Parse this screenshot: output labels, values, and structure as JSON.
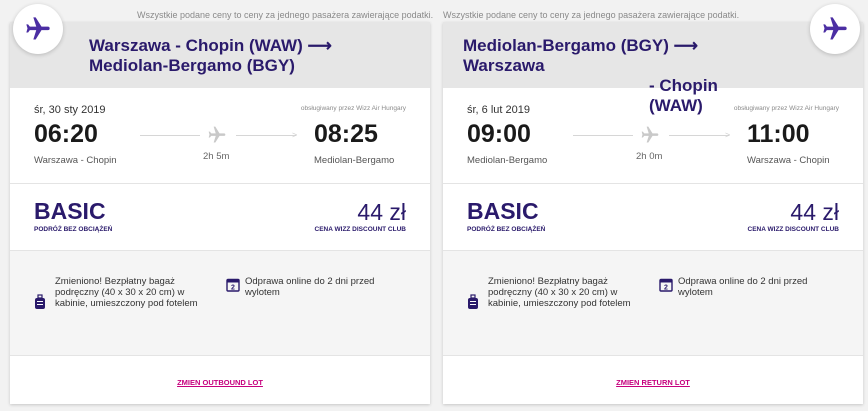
{
  "disclaimer": "Wszystkie podane ceny to ceny za jednego pasażera zawierające podatki.",
  "outbound": {
    "route_line1": "Warszawa - Chopin (WAW) ⟶",
    "route_line2": "Mediolan-Bergamo (BGY)",
    "date": "śr, 30 sty 2019",
    "operated_by": "obsługiwany przez Wizz Air Hungary",
    "dep_time": "06:20",
    "arr_time": "08:25",
    "dep_city": "Warszawa - Chopin",
    "arr_city": "Mediolan-Bergamo",
    "duration": "2h 5m",
    "fare_name": "BASIC",
    "fare_sub": "PODRÓŻ BEZ OBCIĄŻEŃ",
    "price": "44 zł",
    "price_sub": "CENA WIZZ DISCOUNT CLUB",
    "bag_info": "Zmieniono! Bezpłatny bagaż podręczny (40 x 30 x 20 cm) w kabinie, umieszczony pod fotelem",
    "checkin_info": "Odprawa online do 2 dni przed wylotem",
    "change_link": "ZMIEN OUTBOUND LOT"
  },
  "return": {
    "route_line1": "Mediolan-Bergamo (BGY) ⟶ Warszawa",
    "route_line2": "- Chopin (WAW)",
    "date": "śr, 6 lut 2019",
    "operated_by": "obsługiwany przez Wizz Air Hungary",
    "dep_time": "09:00",
    "arr_time": "11:00",
    "dep_city": "Mediolan-Bergamo",
    "arr_city": "Warszawa - Chopin",
    "duration": "2h 0m",
    "fare_name": "BASIC",
    "fare_sub": "PODRÓŻ BEZ OBCIĄŻEŃ",
    "price": "44 zł",
    "price_sub": "CENA WIZZ DISCOUNT CLUB",
    "bag_info": "Zmieniono! Bezpłatny bagaż podręczny (40 x 30 x 20 cm) w kabinie, umieszczony pod fotelem",
    "checkin_info": "Odprawa online do 2 dni przed wylotem",
    "change_link": "ZMIEN RETURN LOT"
  },
  "colors": {
    "brand_purple": "#2a1a6b",
    "link_pink": "#c6007e"
  }
}
